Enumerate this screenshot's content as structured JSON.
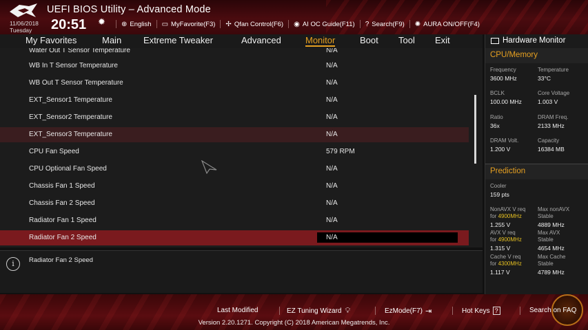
{
  "header": {
    "title": "UEFI BIOS Utility – Advanced Mode",
    "date": "11/06/2018",
    "day": "Tuesday",
    "time": "20:51",
    "toolbar": [
      {
        "icon": "globe-icon",
        "glyph": "⊕",
        "label": "English"
      },
      {
        "icon": "favorite-icon",
        "glyph": "▭",
        "label": "MyFavorite(F3)"
      },
      {
        "icon": "fan-icon",
        "glyph": "✢",
        "label": "Qfan Control(F6)"
      },
      {
        "icon": "ai-oc-icon",
        "glyph": "◉",
        "label": "AI OC Guide(F11)"
      },
      {
        "icon": "search-icon",
        "glyph": "?",
        "label": "Search(F9)"
      },
      {
        "icon": "aura-icon",
        "glyph": "✺",
        "label": "AURA ON/OFF(F4)"
      }
    ]
  },
  "tabs": [
    "My Favorites",
    "Main",
    "Extreme Tweaker",
    "Advanced",
    "Monitor",
    "Boot",
    "Tool",
    "Exit"
  ],
  "active_tab": "Monitor",
  "rows": [
    {
      "label": "Water Out T Sensor Temperature",
      "value": "N/A"
    },
    {
      "label": "WB In T Sensor Temperature",
      "value": "N/A"
    },
    {
      "label": "WB Out T Sensor Temperature",
      "value": "N/A"
    },
    {
      "label": "EXT_Sensor1  Temperature",
      "value": "N/A"
    },
    {
      "label": "EXT_Sensor2  Temperature",
      "value": "N/A"
    },
    {
      "label": "EXT_Sensor3  Temperature",
      "value": "N/A"
    },
    {
      "label": "CPU Fan Speed",
      "value": "579 RPM"
    },
    {
      "label": "CPU Optional Fan Speed",
      "value": "N/A"
    },
    {
      "label": "Chassis Fan 1 Speed",
      "value": "N/A"
    },
    {
      "label": "Chassis Fan 2 Speed",
      "value": "N/A"
    },
    {
      "label": "Radiator Fan 1 Speed",
      "value": "N/A"
    },
    {
      "label": "Radiator Fan 2 Speed",
      "value": "N/A"
    }
  ],
  "help_text": "Radiator Fan 2 Speed",
  "hw": {
    "title": "Hardware Monitor",
    "cpu_memory": "CPU/Memory",
    "frequency_k": "Frequency",
    "frequency_v": "3600 MHz",
    "temperature_k": "Temperature",
    "temperature_v": "33°C",
    "bclk_k": "BCLK",
    "bclk_v": "100.00 MHz",
    "core_voltage_k": "Core Voltage",
    "core_voltage_v": "1.003 V",
    "ratio_k": "Ratio",
    "ratio_v": "36x",
    "dram_freq_k": "DRAM Freq.",
    "dram_freq_v": "2133 MHz",
    "dram_volt_k": "DRAM Volt.",
    "dram_volt_v": "1.200 V",
    "capacity_k": "Capacity",
    "capacity_v": "16384 MB",
    "prediction": "Prediction",
    "cooler_k": "Cooler",
    "cooler_v": "159 pts",
    "nonavx_k1": "NonAVX V req",
    "nonavx_k2": "for",
    "nonavx_freq": "4900MHz",
    "nonavx_v": "1.255 V",
    "max_nonavx_k1": "Max nonAVX",
    "max_nonavx_k2": "Stable",
    "max_nonavx_v": "4889 MHz",
    "avx_k1": "AVX V req",
    "avx_k2": "for",
    "avx_freq": "4900MHz",
    "avx_v": "1.315 V",
    "max_avx_k1": "Max AVX",
    "max_avx_k2": "Stable",
    "max_avx_v": "4654 MHz",
    "cache_k1": "Cache V req",
    "cache_k2": "for",
    "cache_freq": "4300MHz",
    "cache_v": "1.117 V",
    "max_cache_k1": "Max Cache",
    "max_cache_k2": "Stable",
    "max_cache_v": "4789 MHz"
  },
  "footer": {
    "last_modified": "Last Modified",
    "ez_tuning": "EZ Tuning Wizard",
    "ezmode": "EzMode(F7)",
    "hotkeys": "Hot Keys",
    "hotkeys_key": "?",
    "search_faq": "Search on FAQ",
    "version": "Version 2.20.1271. Copyright (C) 2018 American Megatrends, Inc."
  },
  "colors": {
    "accent": "#e6a021",
    "selected_row": "#7a1a1e",
    "header_red": "#4a0b0f"
  }
}
